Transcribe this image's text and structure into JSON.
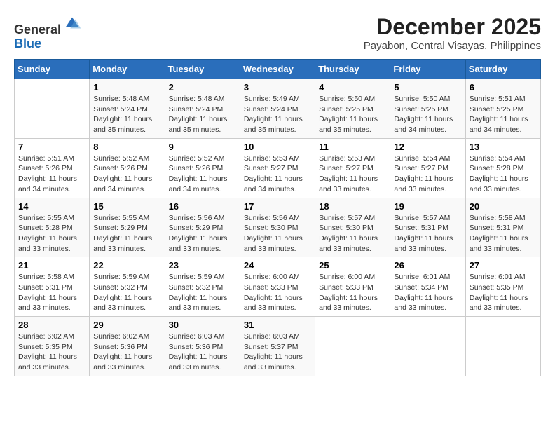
{
  "logo": {
    "general": "General",
    "blue": "Blue"
  },
  "title": {
    "month_year": "December 2025",
    "location": "Payabon, Central Visayas, Philippines"
  },
  "days_of_week": [
    "Sunday",
    "Monday",
    "Tuesday",
    "Wednesday",
    "Thursday",
    "Friday",
    "Saturday"
  ],
  "weeks": [
    [
      {
        "day": "",
        "info": ""
      },
      {
        "day": "1",
        "info": "Sunrise: 5:48 AM\nSunset: 5:24 PM\nDaylight: 11 hours\nand 35 minutes."
      },
      {
        "day": "2",
        "info": "Sunrise: 5:48 AM\nSunset: 5:24 PM\nDaylight: 11 hours\nand 35 minutes."
      },
      {
        "day": "3",
        "info": "Sunrise: 5:49 AM\nSunset: 5:24 PM\nDaylight: 11 hours\nand 35 minutes."
      },
      {
        "day": "4",
        "info": "Sunrise: 5:50 AM\nSunset: 5:25 PM\nDaylight: 11 hours\nand 35 minutes."
      },
      {
        "day": "5",
        "info": "Sunrise: 5:50 AM\nSunset: 5:25 PM\nDaylight: 11 hours\nand 34 minutes."
      },
      {
        "day": "6",
        "info": "Sunrise: 5:51 AM\nSunset: 5:25 PM\nDaylight: 11 hours\nand 34 minutes."
      }
    ],
    [
      {
        "day": "7",
        "info": "Sunrise: 5:51 AM\nSunset: 5:26 PM\nDaylight: 11 hours\nand 34 minutes."
      },
      {
        "day": "8",
        "info": "Sunrise: 5:52 AM\nSunset: 5:26 PM\nDaylight: 11 hours\nand 34 minutes."
      },
      {
        "day": "9",
        "info": "Sunrise: 5:52 AM\nSunset: 5:26 PM\nDaylight: 11 hours\nand 34 minutes."
      },
      {
        "day": "10",
        "info": "Sunrise: 5:53 AM\nSunset: 5:27 PM\nDaylight: 11 hours\nand 34 minutes."
      },
      {
        "day": "11",
        "info": "Sunrise: 5:53 AM\nSunset: 5:27 PM\nDaylight: 11 hours\nand 33 minutes."
      },
      {
        "day": "12",
        "info": "Sunrise: 5:54 AM\nSunset: 5:27 PM\nDaylight: 11 hours\nand 33 minutes."
      },
      {
        "day": "13",
        "info": "Sunrise: 5:54 AM\nSunset: 5:28 PM\nDaylight: 11 hours\nand 33 minutes."
      }
    ],
    [
      {
        "day": "14",
        "info": "Sunrise: 5:55 AM\nSunset: 5:28 PM\nDaylight: 11 hours\nand 33 minutes."
      },
      {
        "day": "15",
        "info": "Sunrise: 5:55 AM\nSunset: 5:29 PM\nDaylight: 11 hours\nand 33 minutes."
      },
      {
        "day": "16",
        "info": "Sunrise: 5:56 AM\nSunset: 5:29 PM\nDaylight: 11 hours\nand 33 minutes."
      },
      {
        "day": "17",
        "info": "Sunrise: 5:56 AM\nSunset: 5:30 PM\nDaylight: 11 hours\nand 33 minutes."
      },
      {
        "day": "18",
        "info": "Sunrise: 5:57 AM\nSunset: 5:30 PM\nDaylight: 11 hours\nand 33 minutes."
      },
      {
        "day": "19",
        "info": "Sunrise: 5:57 AM\nSunset: 5:31 PM\nDaylight: 11 hours\nand 33 minutes."
      },
      {
        "day": "20",
        "info": "Sunrise: 5:58 AM\nSunset: 5:31 PM\nDaylight: 11 hours\nand 33 minutes."
      }
    ],
    [
      {
        "day": "21",
        "info": "Sunrise: 5:58 AM\nSunset: 5:31 PM\nDaylight: 11 hours\nand 33 minutes."
      },
      {
        "day": "22",
        "info": "Sunrise: 5:59 AM\nSunset: 5:32 PM\nDaylight: 11 hours\nand 33 minutes."
      },
      {
        "day": "23",
        "info": "Sunrise: 5:59 AM\nSunset: 5:32 PM\nDaylight: 11 hours\nand 33 minutes."
      },
      {
        "day": "24",
        "info": "Sunrise: 6:00 AM\nSunset: 5:33 PM\nDaylight: 11 hours\nand 33 minutes."
      },
      {
        "day": "25",
        "info": "Sunrise: 6:00 AM\nSunset: 5:33 PM\nDaylight: 11 hours\nand 33 minutes."
      },
      {
        "day": "26",
        "info": "Sunrise: 6:01 AM\nSunset: 5:34 PM\nDaylight: 11 hours\nand 33 minutes."
      },
      {
        "day": "27",
        "info": "Sunrise: 6:01 AM\nSunset: 5:35 PM\nDaylight: 11 hours\nand 33 minutes."
      }
    ],
    [
      {
        "day": "28",
        "info": "Sunrise: 6:02 AM\nSunset: 5:35 PM\nDaylight: 11 hours\nand 33 minutes."
      },
      {
        "day": "29",
        "info": "Sunrise: 6:02 AM\nSunset: 5:36 PM\nDaylight: 11 hours\nand 33 minutes."
      },
      {
        "day": "30",
        "info": "Sunrise: 6:03 AM\nSunset: 5:36 PM\nDaylight: 11 hours\nand 33 minutes."
      },
      {
        "day": "31",
        "info": "Sunrise: 6:03 AM\nSunset: 5:37 PM\nDaylight: 11 hours\nand 33 minutes."
      },
      {
        "day": "",
        "info": ""
      },
      {
        "day": "",
        "info": ""
      },
      {
        "day": "",
        "info": ""
      }
    ]
  ]
}
